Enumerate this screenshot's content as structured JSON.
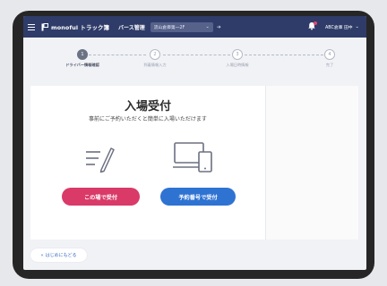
{
  "header": {
    "brand": "monoful トラック簿",
    "menu_label": "バース管理",
    "site_select": "流山倉庫第一2F",
    "user_name": "ABC倉庫 田中"
  },
  "stepper": {
    "steps": [
      {
        "number": "1",
        "label": "ドライバー情報確認",
        "active": true
      },
      {
        "number": "2",
        "label": "到着情報入力",
        "active": false
      },
      {
        "number": "3",
        "label": "入場日時情報",
        "active": false
      },
      {
        "number": "4",
        "label": "完了",
        "active": false
      }
    ]
  },
  "main": {
    "title": "入場受付",
    "subtitle": "事前にご予約いただくと簡単に入場いただけます",
    "onsite_button": "この場で受付",
    "reservation_button": "予約番号で受付"
  },
  "footer": {
    "back_label": "はじめにもどる"
  },
  "colors": {
    "header_bg": "#2f3c69",
    "onsite_button": "#d93a68",
    "reservation_button": "#2f73d2"
  }
}
